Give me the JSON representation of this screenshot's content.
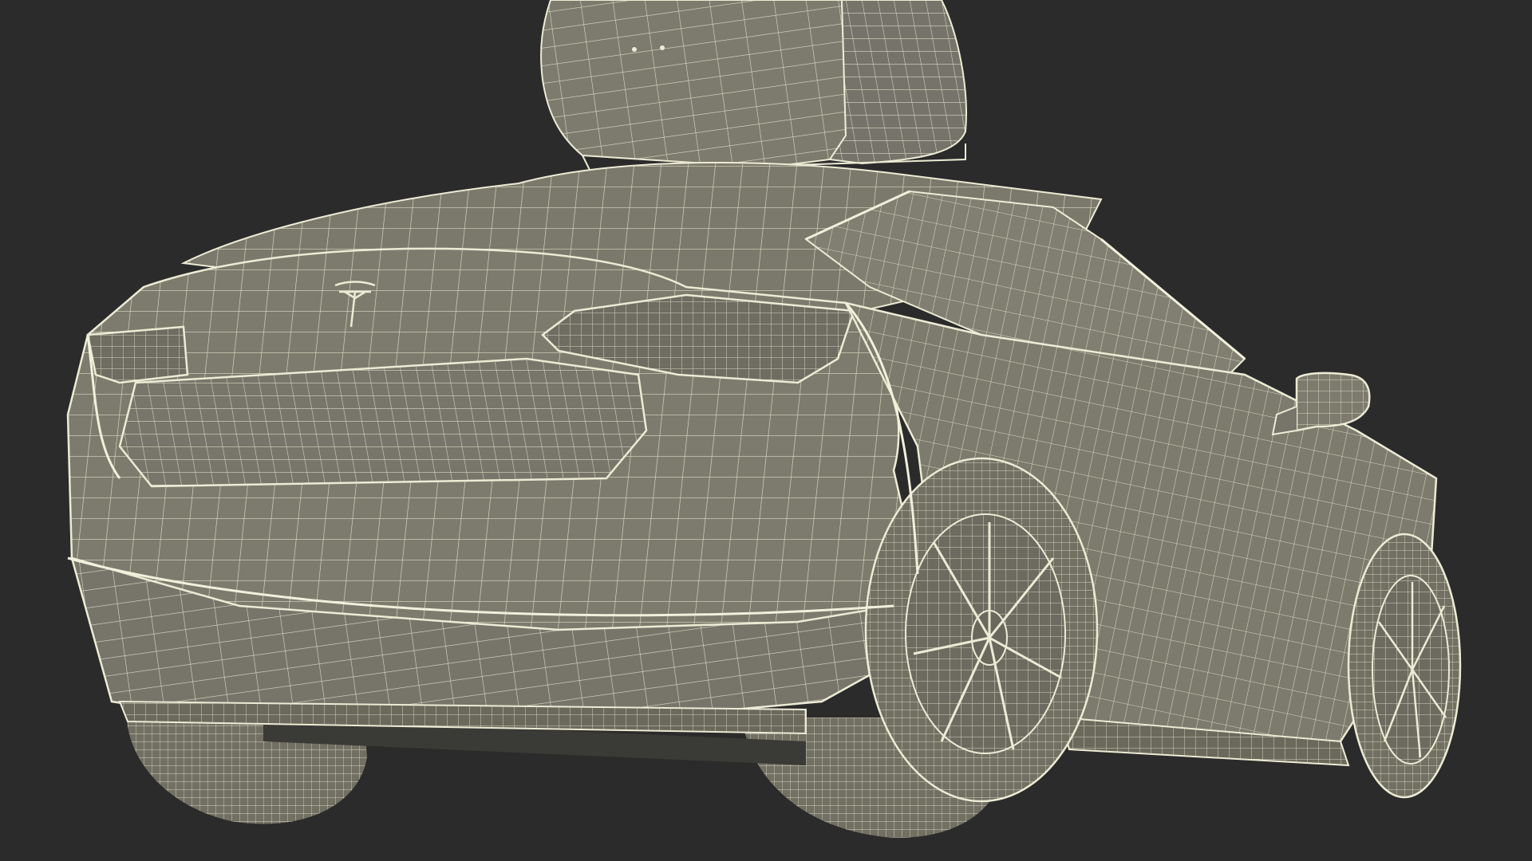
{
  "scene": {
    "subject": "wireframe-car-with-roof-box",
    "logo": "Tesla",
    "colors": {
      "background": "#2b2b2b",
      "surface": "#7d7b6d",
      "surface_dark": "#6b695c",
      "wire": "#ecebd5",
      "wire_faint": "#d9d7bd",
      "tire": "#727063",
      "shadow": "#3a3a36"
    }
  }
}
